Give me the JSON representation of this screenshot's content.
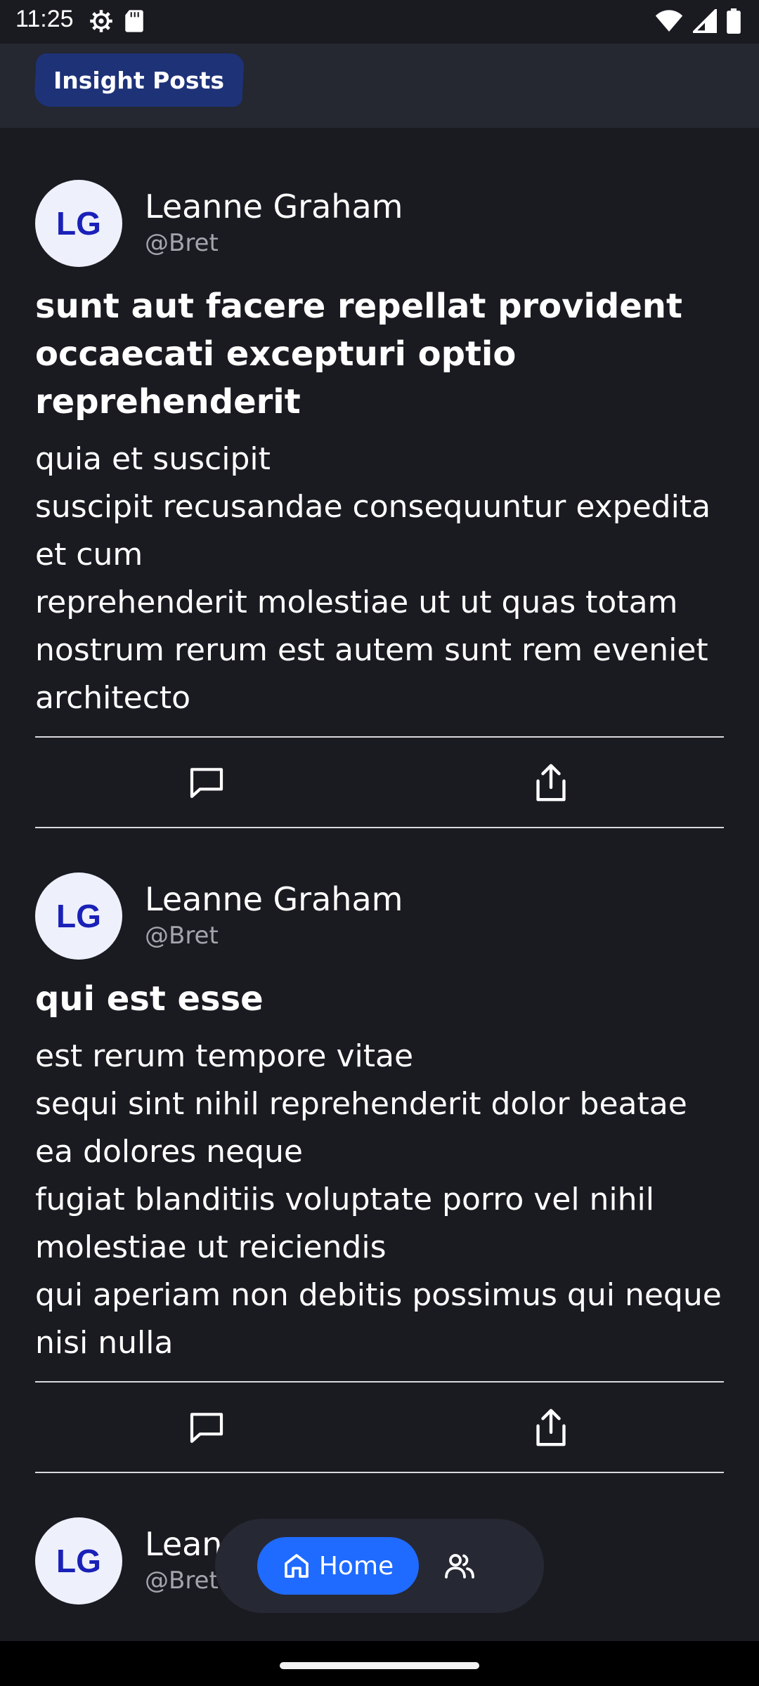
{
  "status_bar": {
    "time": "11:25"
  },
  "header": {
    "title": "Insight Posts"
  },
  "posts": [
    {
      "avatar_initials": "LG",
      "author_name": "Leanne Graham",
      "author_handle": "@Bret",
      "title": "sunt aut facere repellat provident occaecati excepturi optio reprehenderit",
      "body": "quia et suscipit\nsuscipit recusandae consequuntur expedita et cum\nreprehenderit molestiae ut ut quas totam\nnostrum rerum est autem sunt rem eveniet architecto"
    },
    {
      "avatar_initials": "LG",
      "author_name": "Leanne Graham",
      "author_handle": "@Bret",
      "title": "qui est esse",
      "body": "est rerum tempore vitae\nsequi sint nihil reprehenderit dolor beatae ea dolores neque\nfugiat blanditiis voluptate porro vel nihil molestiae ut reiciendis\nqui aperiam non debitis possimus qui neque nisi nulla"
    },
    {
      "avatar_initials": "LG",
      "author_name": "Leanne Graham",
      "author_handle": "@Bret"
    }
  ],
  "bottom_nav": {
    "home_label": "Home"
  },
  "colors": {
    "background": "#1a1b21",
    "header": "#252731",
    "badge": "#1e3278",
    "accent": "#1f6bff",
    "avatar_bg": "#eef0fb",
    "avatar_text": "#1a21b8"
  },
  "icons": [
    "settings-icon",
    "sd-card-icon",
    "wifi-icon",
    "signal-icon",
    "battery-icon",
    "comment-icon",
    "share-icon",
    "home-icon",
    "people-icon"
  ]
}
